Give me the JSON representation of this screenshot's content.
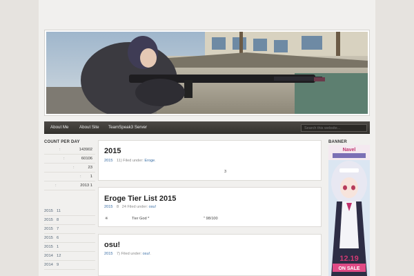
{
  "nav": {
    "items": [
      "About Me",
      "About Site",
      "TeamSpeak3 Server"
    ],
    "search_placeholder": "Search this website..."
  },
  "sidebar_left": {
    "count_title": "COUNT PER DAY",
    "counts": [
      {
        "label": ":",
        "value": "143902"
      },
      {
        "label": ":",
        "value": "60106"
      },
      {
        "label": ":",
        "value": "23"
      },
      {
        "label": ":",
        "value": "1"
      },
      {
        "label": ":",
        "value": "2013  1"
      }
    ],
    "archives": [
      {
        "year": "2015",
        "month": "11"
      },
      {
        "year": "2015",
        "month": "8"
      },
      {
        "year": "2015",
        "month": "7"
      },
      {
        "year": "2015",
        "month": "6"
      },
      {
        "year": "2015",
        "month": "1"
      },
      {
        "year": "2014",
        "month": "12"
      },
      {
        "year": "2014",
        "month": "9"
      }
    ]
  },
  "posts": [
    {
      "title": "2015",
      "meta_date": "2015",
      "meta_mid": "11)",
      "meta_filed": "Filed under:",
      "meta_cat": "Eroge",
      "body": "3"
    },
    {
      "title": "Eroge Tier List     2015",
      "meta_date": "2015",
      "meta_mid": "8",
      "meta_extra": "24",
      "meta_filed": "Filed under:",
      "meta_cat": "osu!",
      "body_left": "※",
      "body_mid": "Tier God *",
      "body_right": "\" 98/100"
    },
    {
      "title": "osu!",
      "meta_date": "2015",
      "meta_mid": "7)",
      "meta_filed": "Filed under:",
      "meta_cat": "osu!"
    }
  ],
  "sidebar_right": {
    "banner_title": "BANNER",
    "banner_top": "Navel",
    "banner_date": "12.19",
    "banner_sale": "ON SALE"
  }
}
